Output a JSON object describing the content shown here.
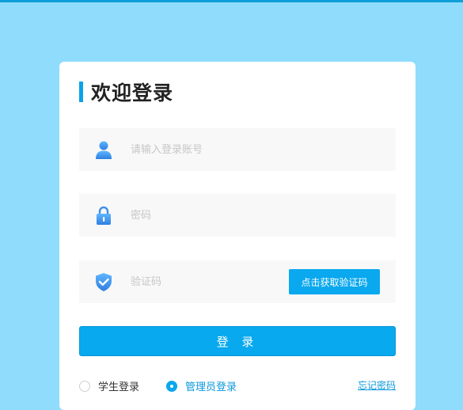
{
  "login": {
    "title": "欢迎登录",
    "username_placeholder": "请输入登录账号",
    "username_value": "",
    "password_placeholder": "密码",
    "password_value": "",
    "captcha_placeholder": "验证码",
    "captcha_value": "",
    "get_code_label": "点击获取验证码",
    "submit_label": "登 录",
    "roles": [
      {
        "label": "学生登录",
        "selected": false
      },
      {
        "label": "管理员登录",
        "selected": true
      }
    ],
    "forgot_label": "忘记密码"
  },
  "icons": {
    "user": "user-icon",
    "lock": "lock-icon",
    "shield": "shield-check-icon"
  },
  "colors": {
    "page_background": "#8fdcfd",
    "accent": "#0aa8ee",
    "link": "#0a98dc"
  }
}
